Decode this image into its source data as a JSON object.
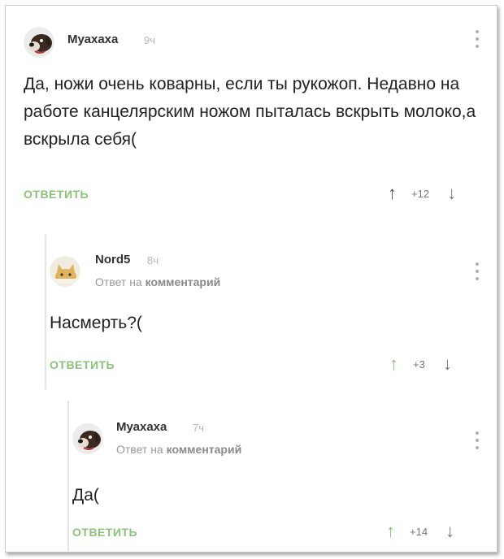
{
  "comments": [
    {
      "author": "Муахаха",
      "time": "9ч",
      "reply_to_prefix": "",
      "reply_to_target": "",
      "text": "Да, ножи очень коварны, если ты рукожоп. Недавно на работе канцелярским ножом пыталась вскрыть молоко,а вскрыла себя(",
      "reply_label": "ОТВЕТИТЬ",
      "rating": "+12",
      "avatar_icon": "dog-avatar"
    },
    {
      "author": "Nord5",
      "time": "8ч",
      "reply_to_prefix": "Ответ на ",
      "reply_to_target": "комментарий",
      "text": "Насмерть?(",
      "reply_label": "ОТВЕТИТЬ",
      "rating": "+3",
      "avatar_icon": "cat-avatar"
    },
    {
      "author": "Муахаха",
      "time": "7ч",
      "reply_to_prefix": "Ответ на ",
      "reply_to_target": "комментарий",
      "text": "Да(",
      "reply_label": "ОТВЕТИТЬ",
      "rating": "+14",
      "avatar_icon": "dog-avatar"
    }
  ],
  "icons": {
    "upvote": "↑",
    "downvote": "↓",
    "more": "more-vertical-icon"
  },
  "colors": {
    "reply_button": "#8cc37a",
    "muted_text": "#9a9a9a",
    "thread_line": "#e6e6e6"
  }
}
